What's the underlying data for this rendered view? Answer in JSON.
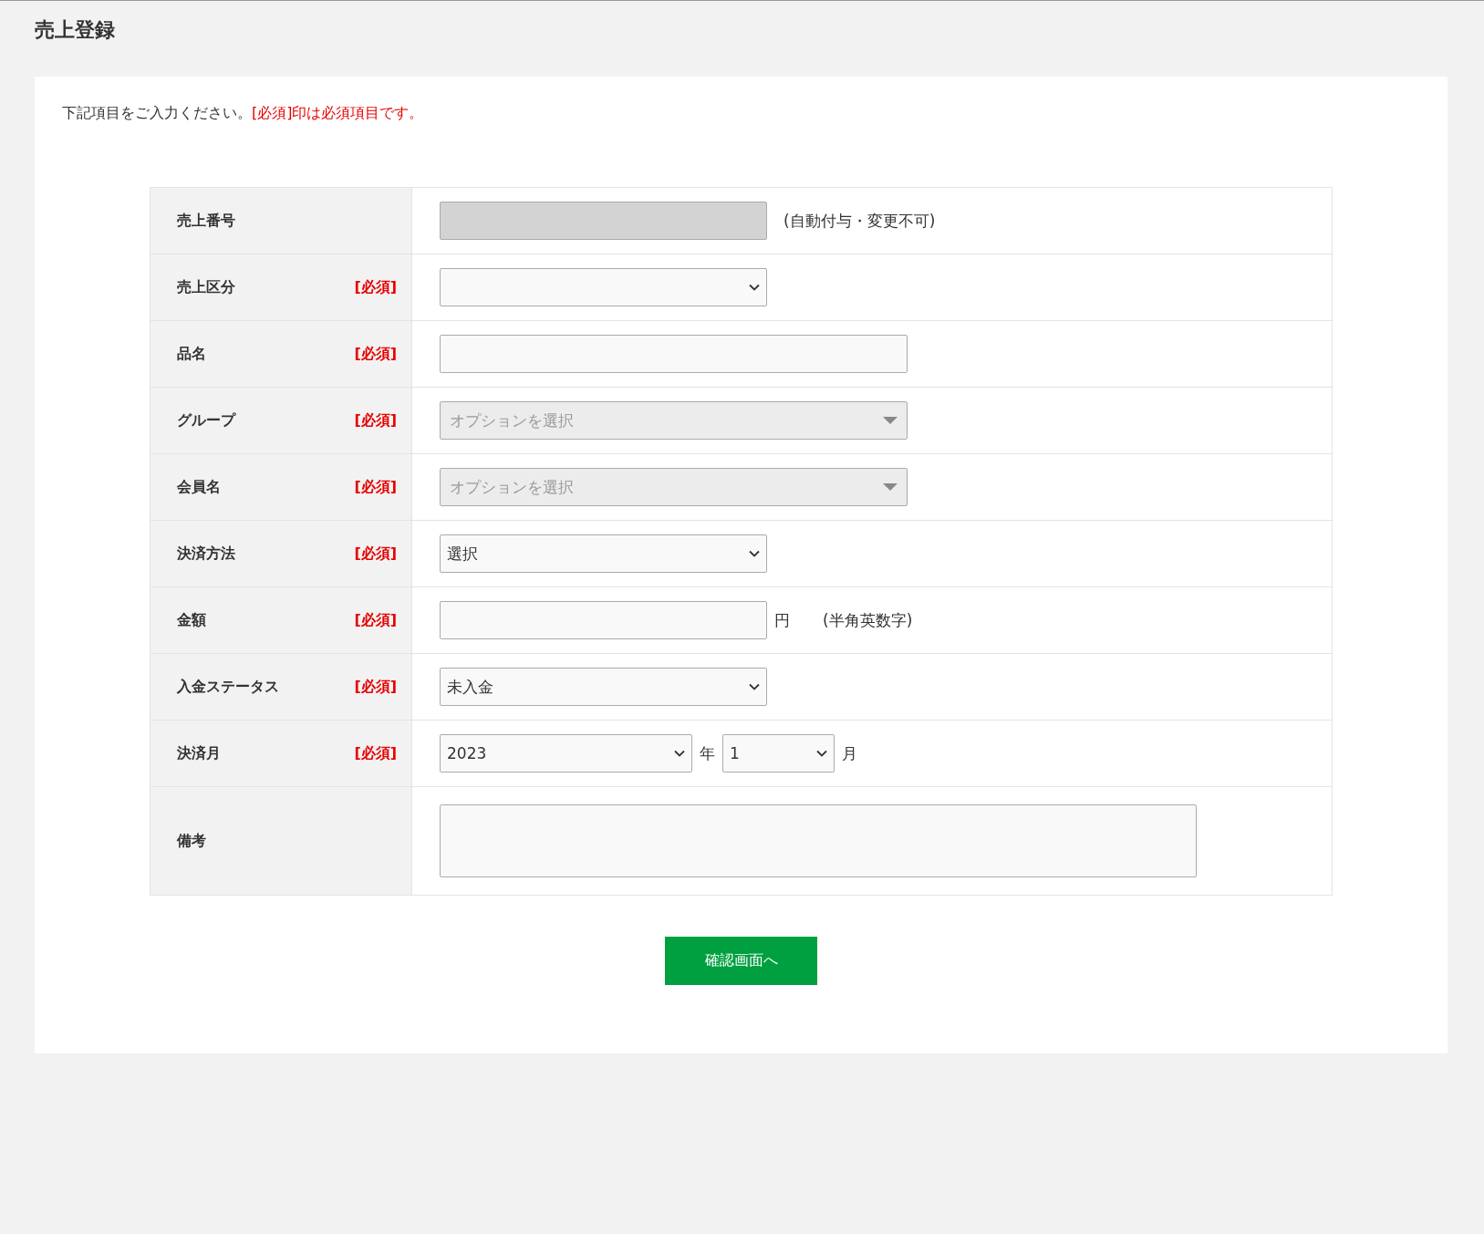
{
  "page_title": "売上登録",
  "intro": {
    "text": "下記項目をご入力ください。",
    "notice": "[必須]印は必須項目です。"
  },
  "rows": [
    {
      "label": "売上番号",
      "kind": "readonly",
      "note": "(自動付与・変更不可)"
    },
    {
      "label": "売上区分",
      "required_mark": "[必須]",
      "kind": "select"
    },
    {
      "label": "品名",
      "required_mark": "[必須]",
      "kind": "text"
    },
    {
      "label": "グループ",
      "required_mark": "[必須]",
      "kind": "combo",
      "placeholder": "オプションを選択"
    },
    {
      "label": "会員名",
      "required_mark": "[必須]",
      "kind": "combo",
      "placeholder": "オプションを選択"
    },
    {
      "label": "決済方法",
      "required_mark": "[必須]",
      "kind": "select",
      "value": "選択"
    },
    {
      "label": "金額",
      "required_mark": "[必須]",
      "kind": "amount",
      "unit": "円",
      "note": "(半角英数字)"
    },
    {
      "label": "入金ステータス",
      "required_mark": "[必須]",
      "kind": "select",
      "value": "未入金"
    },
    {
      "label": "決済月",
      "required_mark": "[必須]",
      "kind": "yearmonth",
      "year": "2023",
      "year_unit": "年",
      "month": "1",
      "month_unit": "月"
    },
    {
      "label": "備考",
      "kind": "textarea"
    }
  ],
  "submit_button": "確認画面へ"
}
